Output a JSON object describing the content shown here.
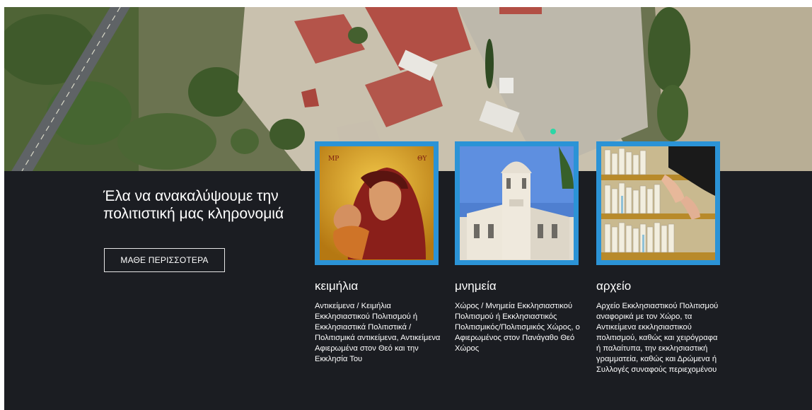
{
  "intro": {
    "heading": "Έλα να ανακαλύψουμε την πολιτιστική μας κληρονομιά",
    "cta_label": "ΜΑΘΕ ΠΕΡΙΣΣΟΤΕΡΑ"
  },
  "cards": [
    {
      "title": "κειμήλια",
      "description": "Αντικείμενα / Κειμήλια Εκκλησιαστικού Πολιτισμού ή Εκκλησιαστικά Πολιτιστικά / Πολιτισμικά αντικείμενα, Αντικείμενα Αφιερωμένα στον Θεό και την Εκκλησία Του",
      "image": "icon-painting-madonna-child"
    },
    {
      "title": "μνημεία",
      "description": "Χώρος / Μνημεία Εκκλησιαστικού Πολιτισμού ή Εκκλησιαστικός Πολιτισμικός/Πολιτισμικός Χώρος, ο Αφιερωμένος στον Πανάγαθο Θεό Χώρος",
      "image": "church-building-photo"
    },
    {
      "title": "αρχείο",
      "description": "Αρχείο Εκκλησιαστικού Πολιτισμού αναφορικά με τον Χώρο, τα Αντικείμενα εκκλησιαστικού πολιτισμού, καθώς και χειρόγραφα ή παλαίτυπα, την εκκλησιαστική γραμματεία, καθώς και Δρώμενα ή Συλλογές συναφούς περιεχομένου",
      "image": "archive-files-photo"
    }
  ],
  "colors": {
    "background_dark": "#1b1d22",
    "card_border": "#2b93d6",
    "text": "#ffffff"
  }
}
